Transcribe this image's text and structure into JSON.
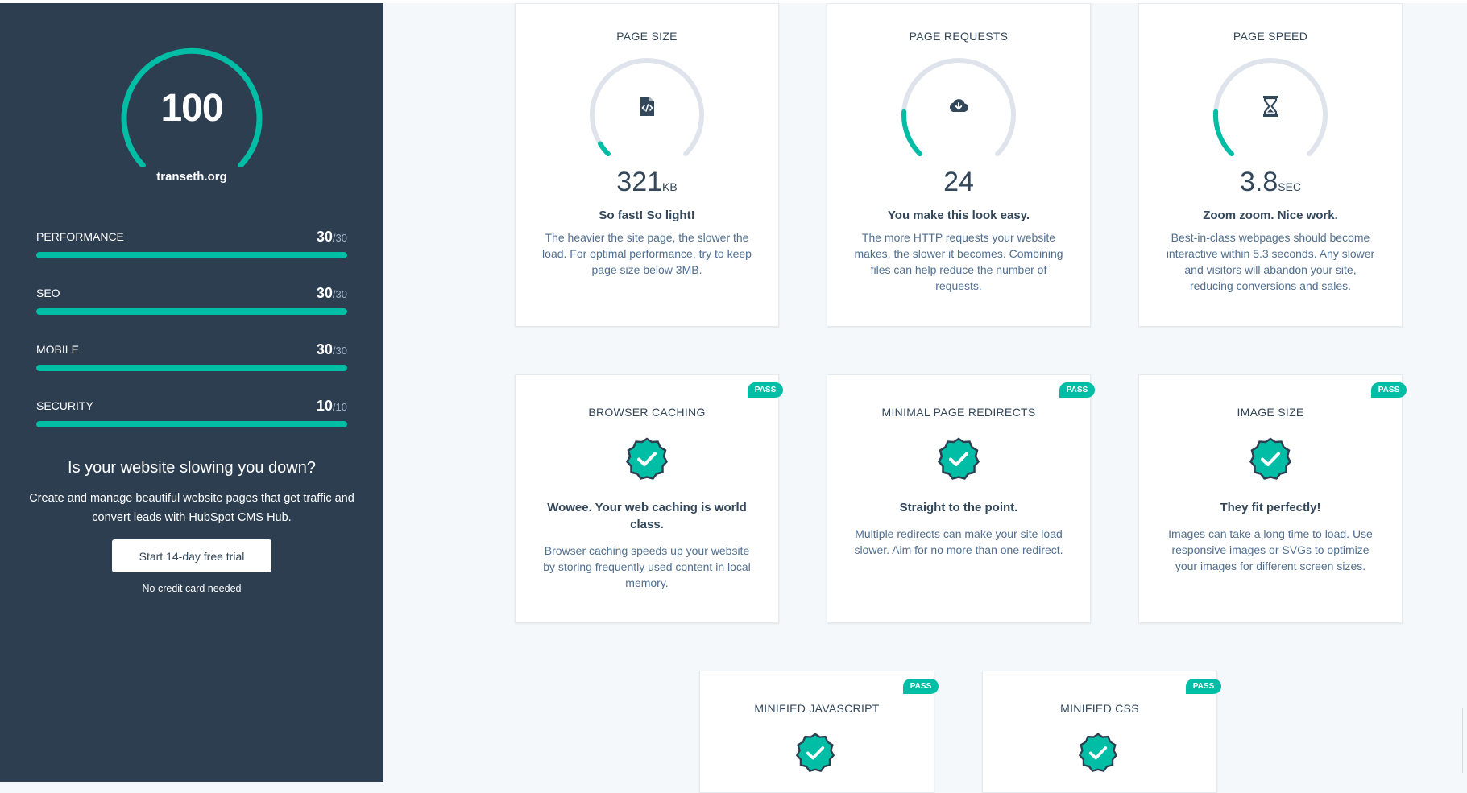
{
  "overall": {
    "score": "100",
    "domain": "transeth.org"
  },
  "metrics": [
    {
      "label": "PERFORMANCE",
      "score": "30",
      "max": "/30"
    },
    {
      "label": "SEO",
      "score": "30",
      "max": "/30"
    },
    {
      "label": "MOBILE",
      "score": "30",
      "max": "/30"
    },
    {
      "label": "SECURITY",
      "score": "10",
      "max": "/10"
    }
  ],
  "promo": {
    "title": "Is your website slowing you down?",
    "text": "Create and manage beautiful website pages that get traffic and convert leads with HubSpot CMS Hub.",
    "button_label": "Start 14-day free trial",
    "footnote": "No credit card needed"
  },
  "gauge_cards": [
    {
      "title": "PAGE SIZE",
      "value": "321",
      "unit": "KB",
      "headline": "So fast! So light!",
      "description": "The heavier the site page, the slower the load. For optimal performance, try to keep page size below 3MB.",
      "icon": "file-code-icon",
      "gauge_fraction": 0.05
    },
    {
      "title": "PAGE REQUESTS",
      "value": "24",
      "unit": "",
      "headline": "You make this look easy.",
      "description": "The more HTTP requests your website makes, the slower it becomes. Combining files can help reduce the number of requests.",
      "icon": "cloud-download-icon",
      "gauge_fraction": 0.18
    },
    {
      "title": "PAGE SPEED",
      "value": "3.8",
      "unit": "SEC",
      "headline": "Zoom zoom. Nice work.",
      "description": "Best-in-class webpages should become interactive within 5.3 seconds. Any slower and visitors will abandon your site, reducing conversions and sales.",
      "icon": "hourglass-icon",
      "gauge_fraction": 0.18
    }
  ],
  "pass_cards": [
    {
      "badge": "PASS",
      "title": "BROWSER CACHING",
      "headline": "Wowee. Your web caching is world class.",
      "description": "Browser caching speeds up your website by storing frequently used content in local memory."
    },
    {
      "badge": "PASS",
      "title": "MINIMAL PAGE REDIRECTS",
      "headline": "Straight to the point.",
      "description": "Multiple redirects can make your site load slower. Aim for no more than one redirect."
    },
    {
      "badge": "PASS",
      "title": "IMAGE SIZE",
      "headline": "They fit perfectly!",
      "description": "Images can take a long time to load. Use responsive images or SVGs to optimize your images for different screen sizes."
    },
    {
      "badge": "PASS",
      "title": "MINIFIED JAVASCRIPT"
    },
    {
      "badge": "PASS",
      "title": "MINIFIED CSS"
    }
  ],
  "colors": {
    "sidebar_bg": "#2d3e50",
    "accent": "#00bda5",
    "text_dark": "#33475b",
    "text_muted": "#516f90",
    "gauge_track": "#dfe3eb"
  }
}
